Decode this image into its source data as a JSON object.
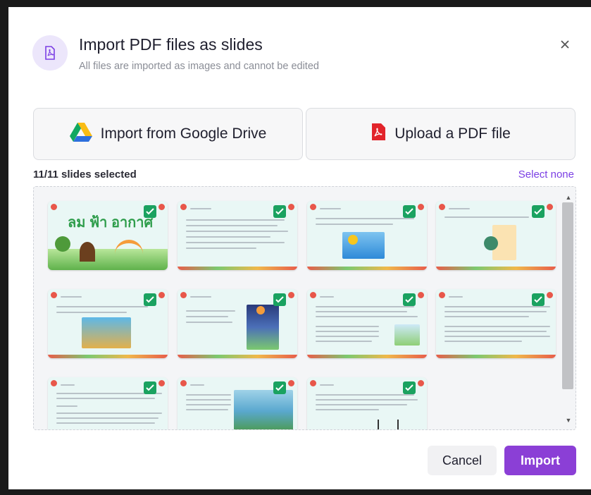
{
  "dialog": {
    "title": "Import PDF files as slides",
    "subtitle": "All files are imported as images and cannot be edited",
    "close_icon": "close-icon"
  },
  "sources": {
    "google_drive_label": "Import from Google Drive",
    "upload_label": "Upload a PDF file"
  },
  "selection": {
    "count_label": "11/11 slides selected",
    "select_none_label": "Select none"
  },
  "slides": [
    {
      "title_text": "ลม ฟ้า อากาศ",
      "selected": true
    },
    {
      "selected": true
    },
    {
      "selected": true
    },
    {
      "selected": true
    },
    {
      "selected": true
    },
    {
      "selected": true
    },
    {
      "selected": true
    },
    {
      "selected": true
    },
    {
      "selected": true
    },
    {
      "selected": true
    },
    {
      "selected": true
    }
  ],
  "footer": {
    "cancel_label": "Cancel",
    "import_label": "Import"
  },
  "colors": {
    "accent": "#8b3fd6",
    "link": "#7b3fe4",
    "check": "#1aa260"
  }
}
